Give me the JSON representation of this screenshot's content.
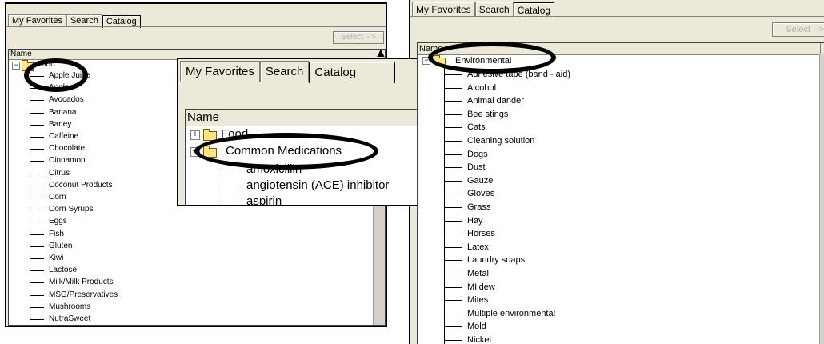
{
  "left_panel": {
    "tabs": [
      "My Favorites",
      "Search",
      "Catalog"
    ],
    "select_button": "Select -->",
    "column_header": "Name",
    "root": "Food",
    "items": [
      "Apple Juice",
      "Apples",
      "Avocados",
      "Banana",
      "Barley",
      "Caffeine",
      "Chocolate",
      "Cinnamon",
      "Citrus",
      "Coconut Products",
      "Corn",
      "Corn Syrups",
      "Eggs",
      "Fish",
      "Gluten",
      "Kiwi",
      "Lactose",
      "Milk/Milk Products",
      "MSG/Preservatives",
      "Mushrooms",
      "NutraSweet"
    ]
  },
  "middle_panel": {
    "tabs": [
      "My Favorites",
      "Search",
      "Catalog"
    ],
    "column_header": "Name",
    "nodes": [
      "Food",
      "Common Medications"
    ],
    "items": [
      "amoxicillin",
      "angiotensin (ACE) inhibitor",
      "aspirin"
    ]
  },
  "right_panel": {
    "tabs": [
      "My Favorites",
      "Search",
      "Catalog"
    ],
    "select_button": "Select -->",
    "column_header": "Name",
    "root": "Environmental",
    "items": [
      "Adhesive tape (band - aid)",
      "Alcohol",
      "Animal dander",
      "Bee stings",
      "Cats",
      "Cleaning solution",
      "Dogs",
      "Dust",
      "Gauze",
      "Gloves",
      "Grass",
      "Hay",
      "Horses",
      "Latex",
      "Laundry soaps",
      "Metal",
      "MIldew",
      "Mites",
      "Multiple environmental",
      "Mold",
      "Nickel"
    ]
  },
  "colors": {
    "annotation_oval": "#000000",
    "folder": "#ffe680",
    "panel_bg": "#ece9d8"
  },
  "icons": {
    "folder": "folder-open-icon",
    "expander": "minus-box-icon",
    "expander_collapsed": "plus-box-icon"
  }
}
